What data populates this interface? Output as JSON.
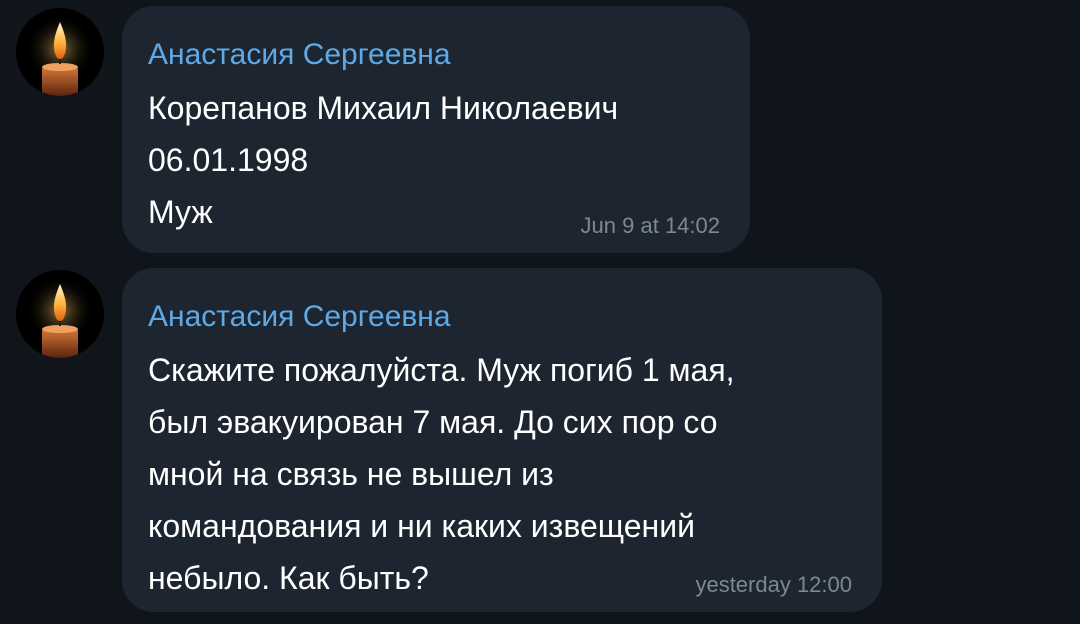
{
  "messages": [
    {
      "sender": "Анастасия Сергеевна",
      "lines": [
        "Корепанов Михаил Николаевич",
        "06.01.1998",
        "Муж"
      ],
      "time": "Jun 9 at 14:02",
      "avatar_icon": "candle-icon"
    },
    {
      "sender": "Анастасия Сергеевна",
      "lines": [
        "Скажите пожалуйста. Муж погиб 1 мая,",
        "был эвакуирован 7 мая. До сих пор со",
        "мной на связь не вышел из",
        "командования и ни каких извещений",
        "небыло. Как быть?"
      ],
      "time": "yesterday 12:00",
      "avatar_icon": "candle-icon"
    }
  ],
  "colors": {
    "background": "#10151c",
    "bubble": "#1c2530",
    "sender_name": "#5fa9e6",
    "message_text": "#ffffff",
    "timestamp": "#7d8893"
  }
}
